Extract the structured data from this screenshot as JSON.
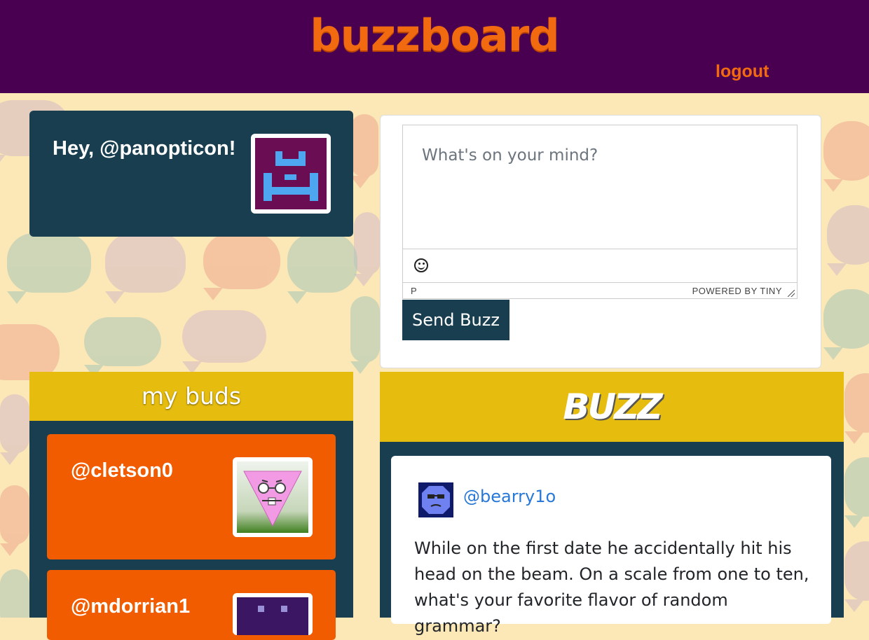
{
  "header": {
    "logo": "buzzboard",
    "logout_label": "logout"
  },
  "greeting": {
    "text": "Hey, @panopticon!"
  },
  "composer": {
    "placeholder": "What's on your mind?",
    "status_path": "P",
    "powered_by": "POWERED BY TINY",
    "send_label": "Send Buzz",
    "emoji_icon": "emoji-icon"
  },
  "buds": {
    "title": "my buds",
    "items": [
      {
        "handle": "@cletson0",
        "avatar": "pink-triangle-face-avatar"
      },
      {
        "handle": "@mdorrian1",
        "avatar": "purple-robot-avatar"
      }
    ]
  },
  "feed": {
    "title": "BUZZ",
    "posts": [
      {
        "author": "@bearry1o",
        "avatar": "blue-face-avatar",
        "text": "While on the first date he accidentally hit his head on the beam. On a scale from one to ten, what's your favorite flavor of random grammar?"
      }
    ]
  },
  "colors": {
    "header_bg": "#4a0050",
    "accent_orange": "#f26a0f",
    "panel_navy": "#193e50",
    "header_yellow": "#e6bd0e",
    "bud_orange": "#f25c00",
    "link_blue": "#2878d8"
  }
}
